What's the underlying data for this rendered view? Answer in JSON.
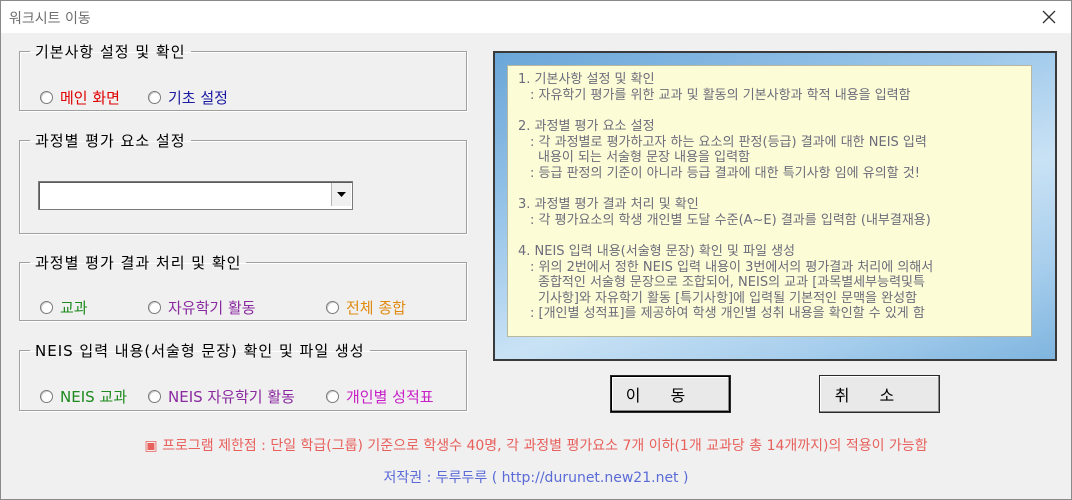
{
  "window": {
    "title": "워크시트 이동"
  },
  "groups": {
    "basic": {
      "legend": "기본사항 설정 및 확인",
      "options": [
        {
          "label": "메인 화면",
          "color": "#e00000"
        },
        {
          "label": "기초 설정",
          "color": "#1a1aa0"
        }
      ]
    },
    "elements": {
      "legend": "과정별 평가 요소 설정",
      "combo_value": ""
    },
    "results": {
      "legend": "과정별 평가 결과 처리 및 확인",
      "options": [
        {
          "label": "교과",
          "color": "#1c8a1c"
        },
        {
          "label": "자유학기 활동",
          "color": "#8a2aa0"
        },
        {
          "label": "전체 종합",
          "color": "#e08a10"
        }
      ]
    },
    "neis": {
      "legend": "NEIS 입력 내용(서술형 문장) 확인 및 파일 생성",
      "options": [
        {
          "label": "NEIS 교과",
          "color": "#1c8a1c"
        },
        {
          "label": "NEIS 자유학기 활동",
          "color": "#8a2aa0"
        },
        {
          "label": "개인별 성적표",
          "color": "#c81ec8"
        }
      ]
    }
  },
  "info": {
    "sections": [
      {
        "lines": [
          "1. 기본사항 설정 및 확인",
          " : 자유학기 평가를 위한 교과 및 활동의 기본사항과 학적 내용을 입력함"
        ]
      },
      {
        "lines": [
          "2. 과정별 평가 요소 설정",
          " : 각 과정별로 평가하고자 하는 요소의 판정(등급) 결과에 대한 NEIS 입력",
          "   내용이 되는 서술형 문장 내용을 입력함",
          " : 등급 판정의 기준이 아니라 등급 결과에 대한 특기사항 임에 유의할 것!"
        ]
      },
      {
        "lines": [
          "3. 과정별 평가 결과 처리 및 확인",
          " : 각 평가요소의 학생 개인별 도달 수준(A~E) 결과를 입력함 (내부결재용)"
        ]
      },
      {
        "lines": [
          "4. NEIS 입력 내용(서술형 문장) 확인 및 파일 생성",
          " : 위의 2번에서 정한 NEIS 입력 내용이 3번에서의 평가결과 처리에 의해서",
          "   종합적인 서술형 문장으로 조합되어, NEIS의 교과 [과목별세부능력및특",
          "   기사항]와 자유학기 활동 [특기사항]에 입력될 기본적인 문맥을 완성함",
          " : [개인별 성적표]를 제공하여 학생 개인별 성취 내용을 확인할 수 있게 함"
        ]
      }
    ]
  },
  "buttons": {
    "move": "이동",
    "cancel": "취소"
  },
  "footer": {
    "notice": "▣ 프로그램 제한점 : 단일 학급(그룹) 기준으로 학생수 40명, 각 과정별 평가요소 7개 이하(1개 교과당 총 14개까지)의 적용이 가능함",
    "copyright": "저작권 : 두루두루 ( http://durunet.new21.net )"
  }
}
